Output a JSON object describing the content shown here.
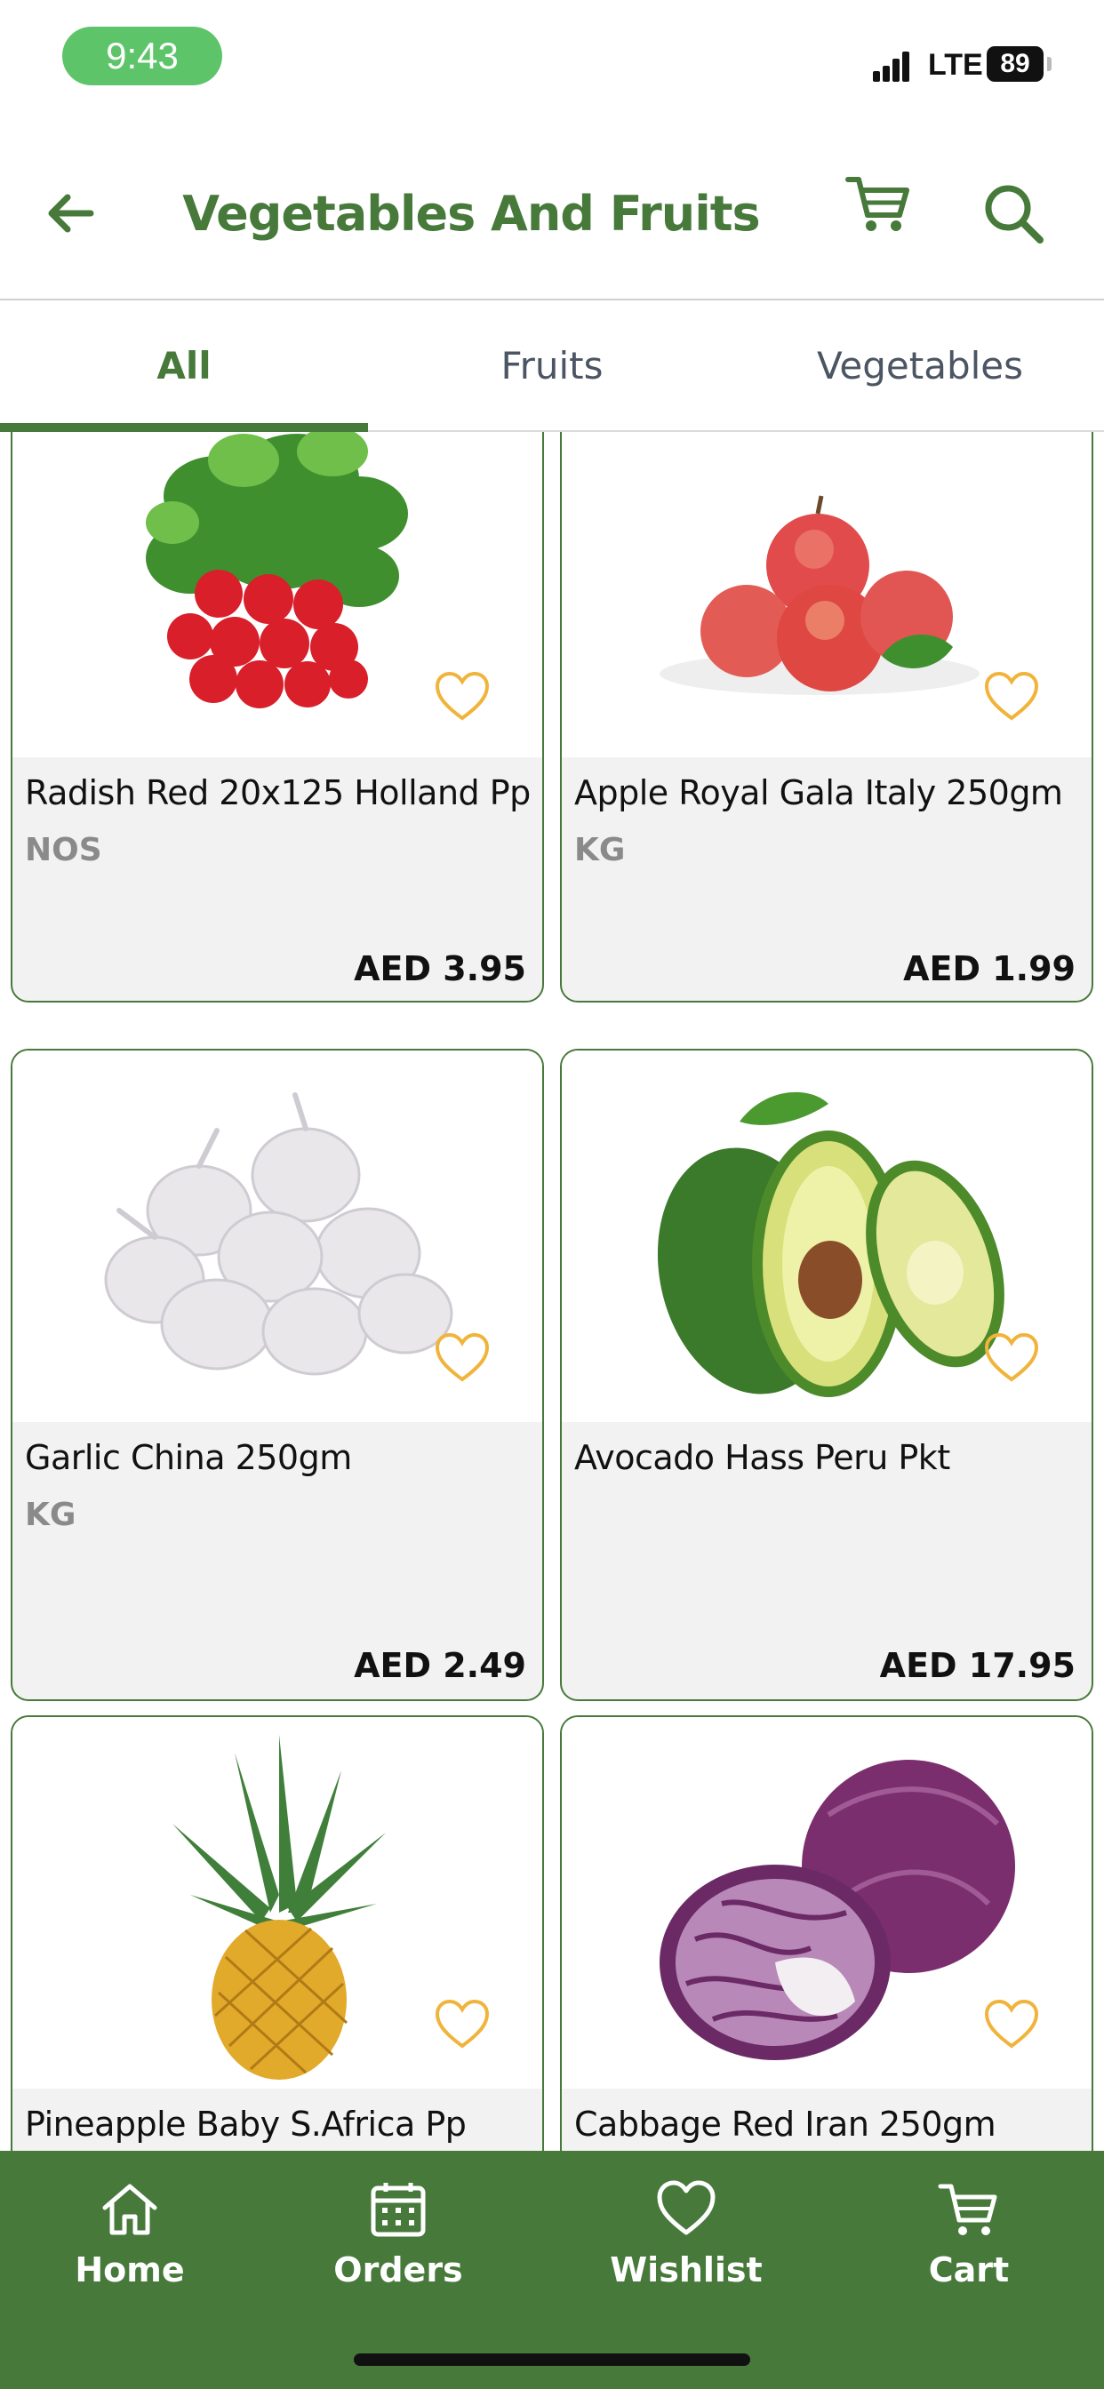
{
  "status_bar": {
    "time": "9:43",
    "network": "LTE",
    "battery": "89"
  },
  "header": {
    "title": "Vegetables And Fruits",
    "back_icon": "arrow-left-icon",
    "cart_icon": "cart-icon",
    "search_icon": "search-icon"
  },
  "tabs": [
    {
      "label": "All",
      "active": true
    },
    {
      "label": "Fruits",
      "active": false
    },
    {
      "label": "Vegetables",
      "active": false
    }
  ],
  "products": [
    {
      "name": "Radish Red 20x125 Holland Pp",
      "unit": "NOS",
      "price": "AED 3.95",
      "image": "radish"
    },
    {
      "name": "Apple Royal Gala Italy 250gm",
      "unit": "KG",
      "price": "AED 1.99",
      "image": "apples"
    },
    {
      "name": "Garlic China 250gm",
      "unit": "KG",
      "price": "AED 2.49",
      "image": "garlic"
    },
    {
      "name": "Avocado Hass Peru Pkt",
      "unit": "",
      "price": "AED 17.95",
      "image": "avocado"
    },
    {
      "name": "Pineapple Baby S.Africa Pp",
      "unit": "",
      "price": "",
      "image": "pineapple"
    },
    {
      "name": "Cabbage Red Iran 250gm",
      "unit": "",
      "price": "",
      "image": "red-cabbage"
    }
  ],
  "bottom_nav": [
    {
      "label": "Home",
      "icon": "home-icon"
    },
    {
      "label": "Orders",
      "icon": "calendar-icon"
    },
    {
      "label": "Wishlist",
      "icon": "heart-icon"
    },
    {
      "label": "Cart",
      "icon": "cart-icon"
    }
  ],
  "colors": {
    "brand": "#46793a",
    "heart": "#f0b43c",
    "card_bg": "#f2f2f2",
    "time_pill": "#5ec46a"
  }
}
